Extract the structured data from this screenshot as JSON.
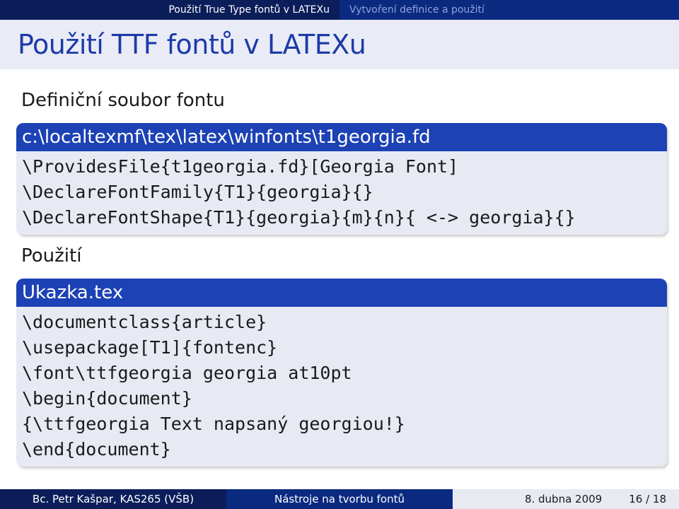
{
  "nav": {
    "section": "Použití True Type fontů v LATEXu",
    "subsection": "Vytvoření definice a použití"
  },
  "frame": {
    "title": "Použití TTF fontů v LATEXu"
  },
  "definition": {
    "heading": "Definiční soubor fontu",
    "block_title": "c:\\localtexmf\\tex\\latex\\winfonts\\t1georgia.fd",
    "code_lines": [
      "\\ProvidesFile{t1georgia.fd}[Georgia Font]",
      "\\DeclareFontFamily{T1}{georgia}{}",
      "\\DeclareFontShape{T1}{georgia}{m}{n}{ <-> georgia}{}"
    ]
  },
  "usage": {
    "heading": "Použití",
    "block_title": "Ukazka.tex",
    "code_lines": [
      "\\documentclass{article}",
      "\\usepackage[T1]{fontenc}",
      "\\font\\ttfgeorgia georgia at10pt",
      "\\begin{document}",
      "{\\ttfgeorgia Text napsaný georgiou!}",
      "\\end{document}"
    ]
  },
  "footer": {
    "author": "Bc. Petr Kašpar, KAS265 (VŠB)",
    "talk": "Nástroje na tvorbu fontů",
    "date": "8. dubna 2009",
    "page": "16 / 18"
  },
  "colors": {
    "nav_dark": "#0b1e5a",
    "nav_mid": "#0a2a80",
    "title_text": "#1d3aa8",
    "block_head": "#1d42b5",
    "block_body": "#e7eaf3"
  }
}
